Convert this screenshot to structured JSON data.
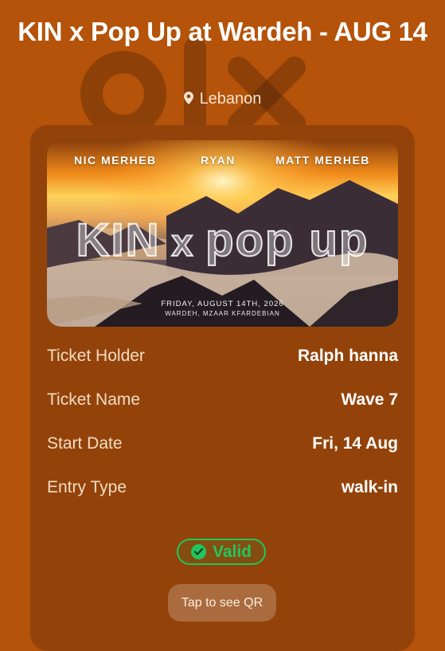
{
  "event": {
    "title": "KIN x Pop Up at Wardeh - AUG 14",
    "location": "Lebanon"
  },
  "watermark": {
    "icon": "olx-logo"
  },
  "poster": {
    "artists": [
      "NIC MERHEB",
      "RYAN",
      "MATT MERHEB"
    ],
    "brand_left": "KIN",
    "brand_x": "x",
    "brand_right": "pop up",
    "date": "FRIDAY, AUGUST 14TH, 2026",
    "venue": "WARDEH, MZAAR KFARDEBIAN"
  },
  "details": [
    {
      "label": "Ticket Holder",
      "value": "Ralph hanna"
    },
    {
      "label": "Ticket Name",
      "value": "Wave 7"
    },
    {
      "label": "Start Date",
      "value": "Fri, 14 Aug"
    },
    {
      "label": "Entry Type",
      "value": "walk-in"
    }
  ],
  "status": {
    "label": "Valid",
    "color": "#22c55e",
    "icon": "check-circle-icon"
  },
  "qr_button": {
    "label": "Tap to see QR"
  },
  "colors": {
    "background": "#b45309",
    "card": "#93430a"
  }
}
